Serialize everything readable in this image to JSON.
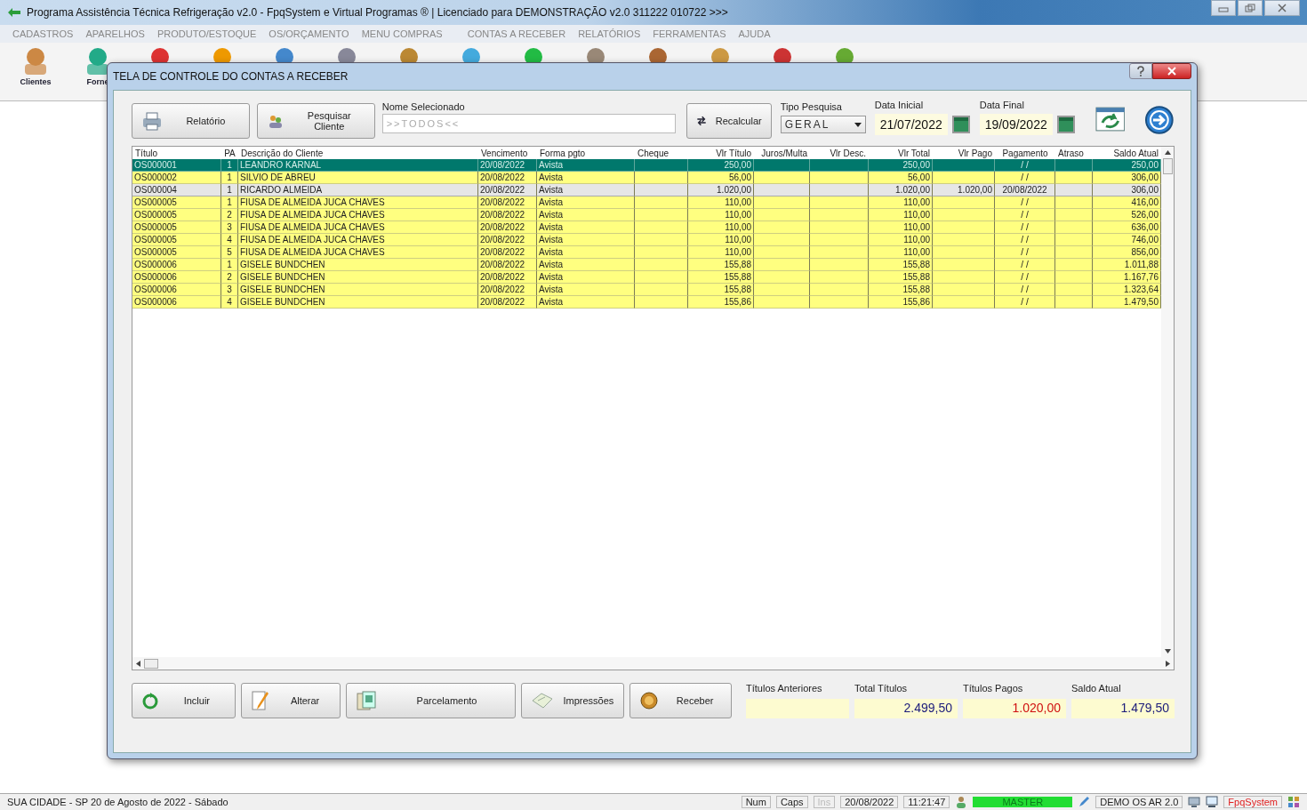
{
  "app": {
    "title": "Programa Assistência Técnica Refrigeração v2.0 - FpqSystem e Virtual Programas ® | Licenciado para  DEMONSTRAÇÃO v2.0 311222 010722 >>>"
  },
  "menu": [
    "CADASTROS",
    "APARELHOS",
    "PRODUTO/ESTOQUE",
    "OS/ORÇAMENTO",
    "MENU COMPRAS",
    "CONTAS A RECEBER",
    "RELATÓRIOS",
    "FERRAMENTAS",
    "AJUDA"
  ],
  "toolbar": [
    {
      "label": "Clientes"
    },
    {
      "label": "Forne"
    }
  ],
  "dialog": {
    "title": "TELA DE CONTROLE DO CONTAS A RECEBER",
    "buttons_top": [
      "Relatório",
      "Pesquisar Cliente"
    ],
    "name_label": "Nome Selecionado",
    "name_value": ">>TODOS<<",
    "recalc": "Recalcular",
    "search_type": {
      "label": "Tipo  Pesquisa",
      "value": "GERAL"
    },
    "date_start": {
      "label": "Data Inicial",
      "value": "21/07/2022"
    },
    "date_end": {
      "label": "Data Final",
      "value": "19/09/2022"
    },
    "columns": [
      "Título",
      "PA",
      "Descrição do Cliente",
      "Vencimento",
      "Forma pgto",
      "Cheque",
      "Vlr Título",
      "Juros/Multa",
      "Vlr Desc.",
      "Vlr Total",
      "Vlr Pago",
      "Pagamento",
      "Atraso",
      "Saldo Atual"
    ],
    "rows": [
      {
        "selected": true,
        "paid": false,
        "cells": [
          "OS000001",
          "1",
          "LEANDRO KARNAL",
          "20/08/2022",
          "Avista",
          null,
          "250,00",
          null,
          null,
          "250,00",
          null,
          "/ /",
          null,
          "250,00"
        ]
      },
      {
        "selected": false,
        "paid": false,
        "cells": [
          "OS000002",
          "1",
          "SILVIO DE ABREU",
          "20/08/2022",
          "Avista",
          null,
          "56,00",
          null,
          null,
          "56,00",
          null,
          "/ /",
          null,
          "306,00"
        ]
      },
      {
        "selected": false,
        "paid": true,
        "cells": [
          "OS000004",
          "1",
          "RICARDO ALMEIDA",
          "20/08/2022",
          "Avista",
          null,
          "1.020,00",
          null,
          null,
          "1.020,00",
          "1.020,00",
          "20/08/2022",
          null,
          "306,00"
        ]
      },
      {
        "selected": false,
        "paid": false,
        "cells": [
          "OS000005",
          "1",
          "FIUSA DE ALMEIDA JUCA CHAVES",
          "20/08/2022",
          "Avista",
          null,
          "110,00",
          null,
          null,
          "110,00",
          null,
          "/ /",
          null,
          "416,00"
        ]
      },
      {
        "selected": false,
        "paid": false,
        "cells": [
          "OS000005",
          "2",
          "FIUSA DE ALMEIDA JUCA CHAVES",
          "20/08/2022",
          "Avista",
          null,
          "110,00",
          null,
          null,
          "110,00",
          null,
          "/ /",
          null,
          "526,00"
        ]
      },
      {
        "selected": false,
        "paid": false,
        "cells": [
          "OS000005",
          "3",
          "FIUSA DE ALMEIDA JUCA CHAVES",
          "20/08/2022",
          "Avista",
          null,
          "110,00",
          null,
          null,
          "110,00",
          null,
          "/ /",
          null,
          "636,00"
        ]
      },
      {
        "selected": false,
        "paid": false,
        "cells": [
          "OS000005",
          "4",
          "FIUSA DE ALMEIDA JUCA CHAVES",
          "20/08/2022",
          "Avista",
          null,
          "110,00",
          null,
          null,
          "110,00",
          null,
          "/ /",
          null,
          "746,00"
        ]
      },
      {
        "selected": false,
        "paid": false,
        "cells": [
          "OS000005",
          "5",
          "FIUSA DE ALMEIDA JUCA CHAVES",
          "20/08/2022",
          "Avista",
          null,
          "110,00",
          null,
          null,
          "110,00",
          null,
          "/ /",
          null,
          "856,00"
        ]
      },
      {
        "selected": false,
        "paid": false,
        "cells": [
          "OS000006",
          "1",
          "GISELE BUNDCHEN",
          "20/08/2022",
          "Avista",
          null,
          "155,88",
          null,
          null,
          "155,88",
          null,
          "/ /",
          null,
          "1.011,88"
        ]
      },
      {
        "selected": false,
        "paid": false,
        "cells": [
          "OS000006",
          "2",
          "GISELE BUNDCHEN",
          "20/08/2022",
          "Avista",
          null,
          "155,88",
          null,
          null,
          "155,88",
          null,
          "/ /",
          null,
          "1.167,76"
        ]
      },
      {
        "selected": false,
        "paid": false,
        "cells": [
          "OS000006",
          "3",
          "GISELE BUNDCHEN",
          "20/08/2022",
          "Avista",
          null,
          "155,88",
          null,
          null,
          "155,88",
          null,
          "/ /",
          null,
          "1.323,64"
        ]
      },
      {
        "selected": false,
        "paid": false,
        "cells": [
          "OS000006",
          "4",
          "GISELE BUNDCHEN",
          "20/08/2022",
          "Avista",
          null,
          "155,86",
          null,
          null,
          "155,86",
          null,
          "/ /",
          null,
          "1.479,50"
        ]
      }
    ],
    "buttons_bottom": [
      {
        "kind": "add",
        "label": "Incluir"
      },
      {
        "kind": "edit",
        "label": "Alterar"
      },
      {
        "kind": "installments",
        "label": "Parcelamento"
      },
      {
        "kind": "print",
        "label": "Impressões"
      },
      {
        "kind": "receive",
        "label": "Receber"
      }
    ],
    "totals": [
      {
        "label": "Títulos Anteriores"
      },
      {
        "label": "Total Títulos",
        "value": "2.499,50",
        "color": "#1a1a7a"
      },
      {
        "label": "Títulos Pagos",
        "value": "1.020,00",
        "color": "#d01010"
      },
      {
        "label": "Saldo Atual",
        "value": "1.479,50",
        "color": "#1a1a7a"
      }
    ]
  },
  "status_bar": {
    "location": "SUA CIDADE - SP 20 de Agosto de 2022 - Sábado",
    "keys": [
      {
        "label": "Num",
        "disabled": false
      },
      {
        "label": "Caps",
        "disabled": false
      },
      {
        "label": "Ins",
        "disabled": true
      }
    ],
    "date": "20/08/2022",
    "time": "11:21:47",
    "user": "MASTER",
    "system": "DEMO OS AR 2.0",
    "brand": "FpqSystem"
  }
}
